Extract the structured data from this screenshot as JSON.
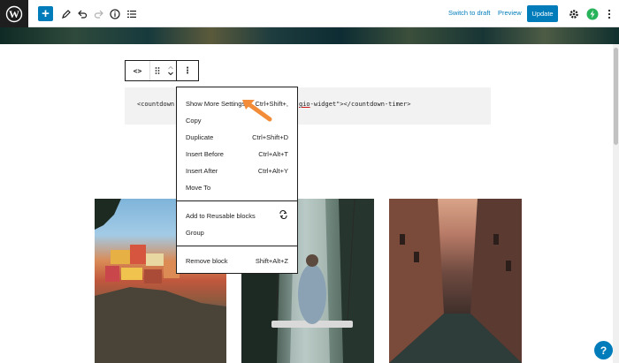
{
  "toolbar": {
    "switch_to_draft": "Switch to draft",
    "preview": "Preview",
    "update": "Update",
    "add_label": "+",
    "icons": [
      "wordpress-logo-icon",
      "add-block-icon",
      "pencil-icon",
      "undo-icon",
      "redo-icon",
      "info-icon",
      "list-view-icon",
      "settings-gear-icon",
      "plugin-bolt-icon",
      "more-options-icon"
    ]
  },
  "block_toolbar": {
    "code_icon": "<>",
    "more_icon": "⋮"
  },
  "code_block": {
    "left_text": "<countdown",
    "right_text": "gio-widget\"></countdown-timer>",
    "right_underlined": "gio"
  },
  "menu": {
    "items": [
      {
        "label": "Show More Settings",
        "shortcut": "Ctrl+Shift+,"
      },
      {
        "label": "Copy",
        "shortcut": ""
      },
      {
        "label": "Duplicate",
        "shortcut": "Ctrl+Shift+D"
      },
      {
        "label": "Insert Before",
        "shortcut": "Ctrl+Alt+T"
      },
      {
        "label": "Insert After",
        "shortcut": "Ctrl+Alt+Y"
      },
      {
        "label": "Move To",
        "shortcut": ""
      },
      {
        "label": "Add to Reusable blocks",
        "shortcut": ""
      },
      {
        "label": "Group",
        "shortcut": ""
      },
      {
        "label": "Remove block",
        "shortcut": "Shift+Alt+Z"
      }
    ]
  },
  "help": {
    "label": "?"
  },
  "colors": {
    "accent": "#007cba",
    "arrow": "#f28c38",
    "menu_border": "#1e1e1e"
  }
}
